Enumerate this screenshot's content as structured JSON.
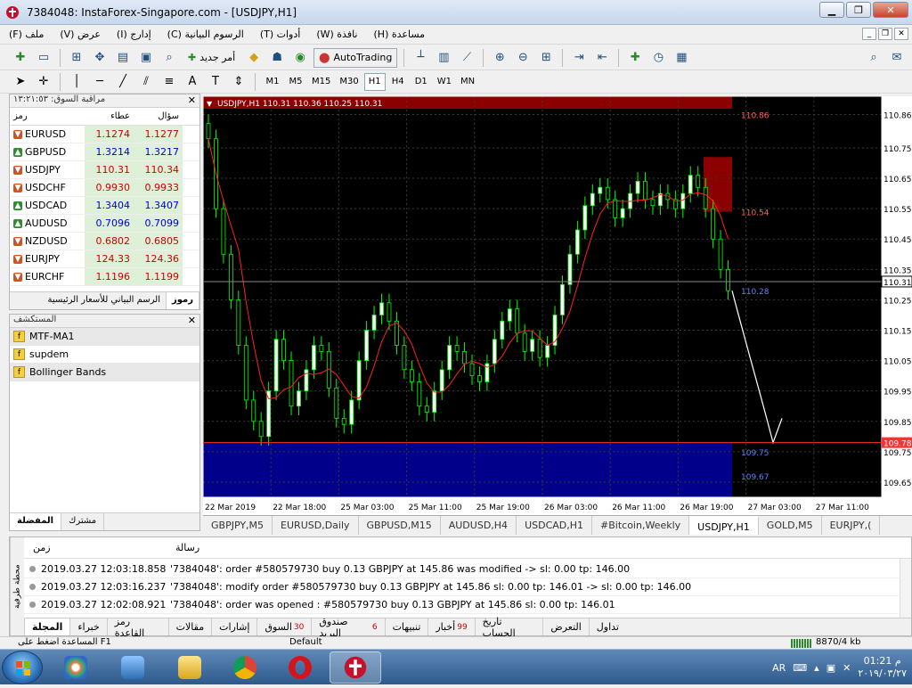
{
  "window": {
    "title": "7384048: InstaForex-Singapore.com - [USDJPY,H1]"
  },
  "menu": {
    "items": [
      "ملف (F)",
      "عرض (V)",
      "إدارج (I)",
      "الرسوم البيانية (C)",
      "أدوات (T)",
      "نافذة (W)",
      "مساعدة (H)"
    ]
  },
  "toolbar": {
    "new_order": "أمر جديد",
    "autotrading": "AutoTrading"
  },
  "timeframes": [
    "M1",
    "M5",
    "M15",
    "M30",
    "H1",
    "H4",
    "D1",
    "W1",
    "MN"
  ],
  "active_timeframe": "H1",
  "market_watch": {
    "title": "مراقبة السوق: ١٣:٢١:٥٣",
    "col_symbol": "رمز",
    "col_bid": "عطاء",
    "col_ask": "سؤال",
    "rows": [
      {
        "symbol": "EURUSD",
        "bid": "1.1274",
        "ask": "1.1277",
        "dir": "down",
        "bid_color": "#cc0000",
        "ask_color": "#cc0000"
      },
      {
        "symbol": "GBPUSD",
        "bid": "1.3214",
        "ask": "1.3217",
        "dir": "up",
        "bid_color": "#0000cc",
        "ask_color": "#0000cc"
      },
      {
        "symbol": "USDJPY",
        "bid": "110.31",
        "ask": "110.34",
        "dir": "down",
        "bid_color": "#cc0000",
        "ask_color": "#cc0000"
      },
      {
        "symbol": "USDCHF",
        "bid": "0.9930",
        "ask": "0.9933",
        "dir": "down",
        "bid_color": "#cc0000",
        "ask_color": "#cc0000"
      },
      {
        "symbol": "USDCAD",
        "bid": "1.3404",
        "ask": "1.3407",
        "dir": "up",
        "bid_color": "#0000cc",
        "ask_color": "#0000cc"
      },
      {
        "symbol": "AUDUSD",
        "bid": "0.7096",
        "ask": "0.7099",
        "dir": "up",
        "bid_color": "#0000cc",
        "ask_color": "#0000cc"
      },
      {
        "symbol": "NZDUSD",
        "bid": "0.6802",
        "ask": "0.6805",
        "dir": "down",
        "bid_color": "#cc0000",
        "ask_color": "#cc0000"
      },
      {
        "symbol": "EURJPY",
        "bid": "124.33",
        "ask": "124.36",
        "dir": "down",
        "bid_color": "#cc0000",
        "ask_color": "#cc0000"
      },
      {
        "symbol": "EURCHF",
        "bid": "1.1196",
        "ask": "1.1199",
        "dir": "down",
        "bid_color": "#cc0000",
        "ask_color": "#cc0000"
      }
    ],
    "tabs": [
      "رموز",
      "الرسم البياني للأسعار الرئيسية"
    ]
  },
  "navigator": {
    "title": "المستكشف",
    "items": [
      "MTF-MA1",
      "supdem",
      "Bollinger Bands"
    ],
    "tabs": [
      "المفضلة",
      "مشترك"
    ]
  },
  "chart": {
    "info": "USDJPY,H1  110.31 110.36 110.25 110.31",
    "price_labels": [
      "110.86",
      "110.75",
      "110.65",
      "110.55",
      "110.45",
      "110.35",
      "110.25",
      "110.15",
      "110.05",
      "109.95",
      "109.85",
      "109.75",
      "109.65"
    ],
    "current_price": "110.31",
    "hline_price": "109.78",
    "zone_labels": [
      "110.86",
      "110.54",
      "110.28",
      "109.75",
      "109.67"
    ],
    "time_labels": [
      "22 Mar 2019",
      "22 Mar 18:00",
      "25 Mar 03:00",
      "25 Mar 11:00",
      "25 Mar 19:00",
      "26 Mar 03:00",
      "26 Mar 11:00",
      "26 Mar 19:00",
      "27 Mar 03:00",
      "27 Mar 11:00"
    ],
    "colors": {
      "bull": "#ffffff",
      "bear": "#ffffff",
      "wick": "#00ff00",
      "ma": "#ff2020",
      "grid": "#3a3a3a",
      "supply": "#8b0000",
      "demand": "#00008b"
    }
  },
  "chart_tabs": [
    "GBPJPY,M5",
    "EURUSD,Daily",
    "GBPUSD,M15",
    "AUDUSD,H4",
    "USDCAD,H1",
    "#Bitcoin,Weekly",
    "USDJPY,H1",
    "GOLD,M5",
    "EURJPY,("
  ],
  "active_chart_tab": "USDJPY,H1",
  "terminal": {
    "side_label": "محطة طرفية",
    "col_time": "زمن",
    "col_message": "رسالة",
    "rows": [
      {
        "time": "2019.03.27 12:03:18.858",
        "msg": "'7384048': order #580579730 buy 0.13 GBPJPY at 145.86 was modified -> sl: 0.00 tp: 146.00"
      },
      {
        "time": "2019.03.27 12:03:16.237",
        "msg": "'7384048': modify order #580579730 buy 0.13 GBPJPY at 145.86 sl: 0.00 tp: 146.01 -> sl: 0.00 tp: 146.00"
      },
      {
        "time": "2019.03.27 12:02:08.921",
        "msg": "'7384048': order was opened : #580579730 buy 0.13 GBPJPY at 145.86 sl: 0.00 tp: 146.01"
      }
    ],
    "tabs": [
      {
        "label": "تداول",
        "badge": ""
      },
      {
        "label": "التعرض",
        "badge": ""
      },
      {
        "label": "تاريخ الحساب",
        "badge": ""
      },
      {
        "label": "أخبار",
        "badge": "99"
      },
      {
        "label": "تنبيهات",
        "badge": ""
      },
      {
        "label": "صندوق البريد",
        "badge": "6"
      },
      {
        "label": "السوق",
        "badge": "30"
      },
      {
        "label": "إشارات",
        "badge": ""
      },
      {
        "label": "مقالات",
        "badge": ""
      },
      {
        "label": "رمز القاعدة",
        "badge": ""
      },
      {
        "label": "خبراء",
        "badge": ""
      },
      {
        "label": "المجلة",
        "badge": ""
      }
    ],
    "active_tab": "المجلة"
  },
  "statusbar": {
    "help": "المساعدة اضغط على F1",
    "profile": "Default",
    "traffic": "8870/4 kb"
  },
  "taskbar": {
    "lang": "AR",
    "time": "01:21 م",
    "date": "٢٠١٩/٠٣/٢٧"
  }
}
